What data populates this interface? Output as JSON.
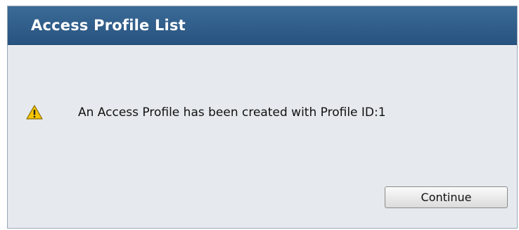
{
  "dialog": {
    "title": "Access Profile List",
    "message": "An Access Profile has been created with Profile ID:1",
    "icon": "warning-icon",
    "continue_label": "Continue"
  },
  "colors": {
    "title_bar": "#2f5c88",
    "panel_background": "#e6eaee",
    "warning_yellow": "#f5c400"
  }
}
